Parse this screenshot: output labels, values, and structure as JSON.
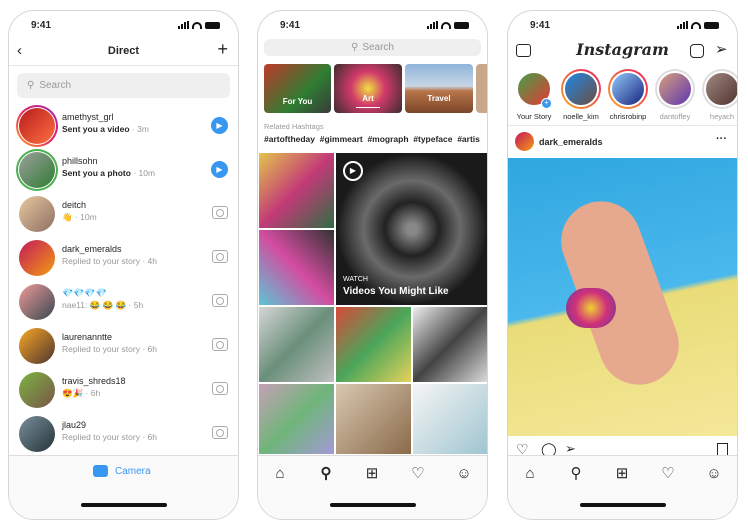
{
  "status_time": "9:41",
  "direct": {
    "title": "Direct",
    "search_placeholder": "Search",
    "threads": [
      {
        "user": "amethyst_grl",
        "message": "Sent you a video",
        "time": "3m",
        "unread": true,
        "action": "play"
      },
      {
        "user": "phillsohn",
        "message": "Sent you a photo",
        "time": "10m",
        "unread": true,
        "action": "play"
      },
      {
        "user": "deitch",
        "message": "👋",
        "time": "10m",
        "action": "camera"
      },
      {
        "user": "dark_emeralds",
        "message": "Replied to your story",
        "time": "4h",
        "action": "camera"
      },
      {
        "user": "💎💎💎💎",
        "message": "nae11: 😂 😂 😂",
        "time": "5h",
        "action": "camera"
      },
      {
        "user": "laurenanntte",
        "message": "Replied to your story",
        "time": "6h",
        "action": "camera"
      },
      {
        "user": "travis_shreds18",
        "message": "😍🎉",
        "time": "6h",
        "action": "camera"
      },
      {
        "user": "jlau29",
        "message": "Replied to your story",
        "time": "6h",
        "action": "camera"
      }
    ],
    "camera_label": "Camera"
  },
  "explore": {
    "search_placeholder": "Search",
    "categories": [
      "For You",
      "Art",
      "Travel"
    ],
    "related_label": "Related Hashtags",
    "hashtags": "#artoftheday  #gimmeart  #mograph  #typeface  #artis",
    "watch_label": "WATCH",
    "video_title": "Videos You Might Like"
  },
  "feed": {
    "logo": "Instagram",
    "stories": [
      "Your Story",
      "noelle_kim",
      "chrisrobinp",
      "dantoffey",
      "heyach"
    ],
    "post_user": "dark_emeralds"
  },
  "colors": {
    "accent": "#3897f0",
    "text": "#262626",
    "muted": "#999999"
  }
}
